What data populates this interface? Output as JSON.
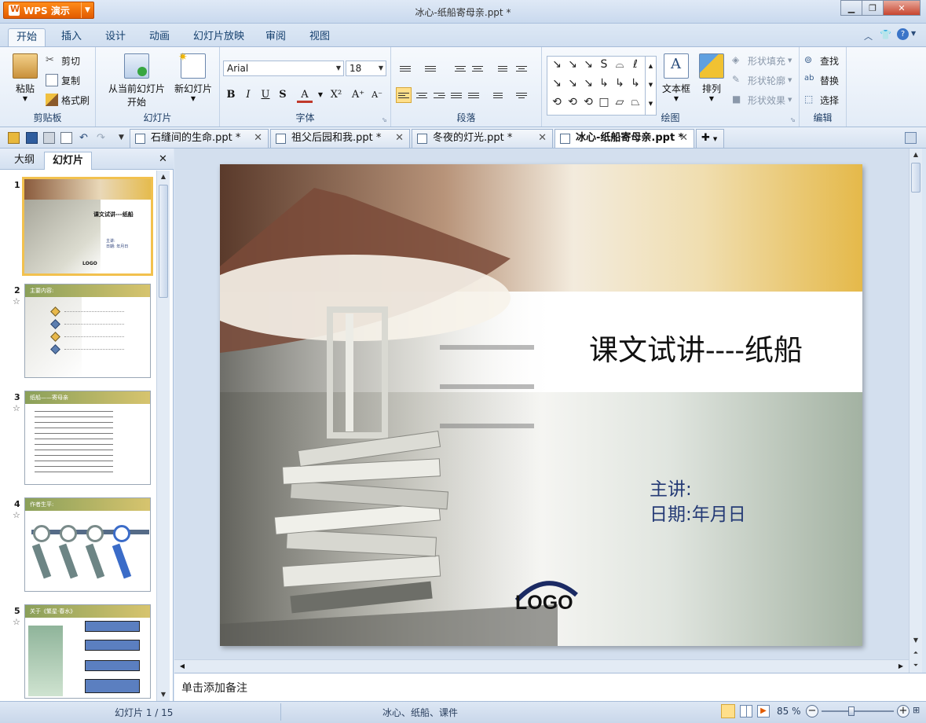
{
  "app": {
    "brand": "WPS 演示",
    "window_title": "冰心-纸船寄母亲.ppt *"
  },
  "ribbon_tabs": [
    "开始",
    "插入",
    "设计",
    "动画",
    "幻灯片放映",
    "审阅",
    "视图"
  ],
  "clipboard": {
    "paste": "粘贴",
    "cut": "剪切",
    "copy": "复制",
    "format_painter": "格式刷",
    "label": "剪贴板"
  },
  "slides_group": {
    "from_current": "从当前幻灯片",
    "from_current_2": "开始",
    "new_slide": "新幻灯片",
    "label": "幻灯片"
  },
  "font": {
    "name": "Arial",
    "size": "18",
    "label": "字体",
    "bold": "B",
    "italic": "I",
    "underline": "U",
    "shadow": "S",
    "color": "A"
  },
  "paragraph": {
    "label": "段落"
  },
  "drawing": {
    "textbox": "文本框",
    "arrange": "排列",
    "shape_fill": "形状填充",
    "shape_outline": "形状轮廓",
    "shape_effect": "形状效果",
    "label": "绘图"
  },
  "editing": {
    "find": "查找",
    "replace": "替换",
    "select": "选择",
    "label": "编辑"
  },
  "doc_tabs": [
    {
      "label": "石缝间的生命.ppt *",
      "active": false
    },
    {
      "label": "祖父后园和我.ppt *",
      "active": false
    },
    {
      "label": "冬夜的灯光.ppt *",
      "active": false
    },
    {
      "label": "冰心-纸船寄母亲.ppt *",
      "active": true
    }
  ],
  "panel": {
    "tab_outline": "大纲",
    "tab_slides": "幻灯片"
  },
  "thumbnails": [
    {
      "num": "1",
      "title": "课文试讲---纸船",
      "lines": [
        "主讲:",
        "日期:  年月日"
      ]
    },
    {
      "num": "2",
      "title": "主要内容:"
    },
    {
      "num": "3",
      "title": "纸船——寄母亲"
    },
    {
      "num": "4",
      "title": "作者生平:"
    },
    {
      "num": "5",
      "title": "关于《繁星·春水》"
    }
  ],
  "slide": {
    "title": "课文试讲----纸船",
    "presenter": "主讲:",
    "date": "日期:年月日",
    "logo": "LOGO"
  },
  "notes_placeholder": "单击添加备注",
  "status": {
    "slide_counter": "幻灯片 1 / 15",
    "keywords": "冰心、纸船、课件",
    "zoom": "85 %"
  },
  "colors": {
    "accent_orange": "#e25b00",
    "slide_gold": "#e7bb4c",
    "slide_sage": "#9fae9d",
    "subtitle_blue": "#243a75"
  }
}
